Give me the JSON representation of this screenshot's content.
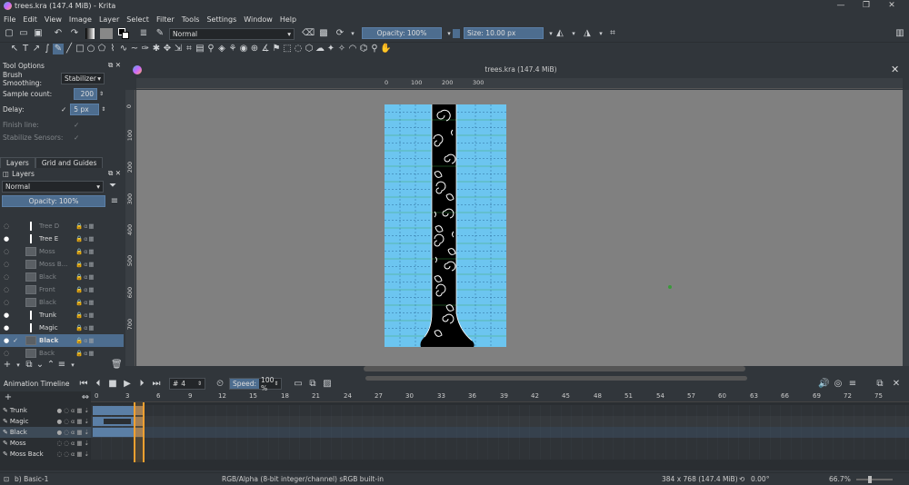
{
  "window": {
    "title": "trees.kra (147.4 MiB)  - Krita",
    "doc_title": "trees.kra (147.4 MiB)"
  },
  "menu": [
    "File",
    "Edit",
    "View",
    "Image",
    "Layer",
    "Select",
    "Filter",
    "Tools",
    "Settings",
    "Window",
    "Help"
  ],
  "toolbar": {
    "blend_mode": "Normal",
    "opacity": "Opacity: 100%",
    "size": "Size: 10.00 px"
  },
  "tool_options": {
    "title": "Tool Options",
    "brush_smoothing_label": "Brush Smoothing:",
    "brush_smoothing_value": "Stabilizer",
    "sample_count_label": "Sample count:",
    "sample_count_value": "200",
    "delay_label": "Delay:",
    "delay_value": "5 px",
    "finish_line_label": "Finish line:",
    "stabilize_label": "Stabilize Sensors:"
  },
  "tabs": {
    "layers": "Layers",
    "grid": "Grid and Guides"
  },
  "layers": {
    "title": "Layers",
    "blend_mode": "Normal",
    "opacity": "Opacity:  100%",
    "items": [
      {
        "name": "Tree D",
        "dim": true
      },
      {
        "name": "Tree E",
        "dim": false
      },
      {
        "name": "Moss",
        "dim": true
      },
      {
        "name": "Moss B...",
        "dim": true
      },
      {
        "name": "Black",
        "dim": true
      },
      {
        "name": "Front",
        "dim": true
      },
      {
        "name": "Black",
        "dim": true
      },
      {
        "name": "Trunk",
        "dim": false
      },
      {
        "name": "Magic",
        "dim": false
      },
      {
        "name": "Black",
        "dim": false,
        "selected": true
      },
      {
        "name": "Back",
        "dim": true
      }
    ]
  },
  "ruler": {
    "top": [
      "0",
      "100",
      "200",
      "300"
    ],
    "left": [
      "0",
      "100",
      "200",
      "300",
      "400",
      "500",
      "600",
      "700"
    ]
  },
  "timeline": {
    "title": "Animation Timeline",
    "frame": "4",
    "speed_label": "Speed:",
    "speed_value": "100 %",
    "frame_numbers": [
      "0",
      "3",
      "6",
      "9",
      "12",
      "15",
      "18",
      "21",
      "24",
      "27",
      "30",
      "33",
      "36",
      "39",
      "42",
      "45",
      "48",
      "51",
      "54",
      "57",
      "60",
      "63",
      "66",
      "69",
      "72",
      "75"
    ],
    "rows": [
      "Trunk",
      "Magic",
      "Black",
      "Moss",
      "Moss Back"
    ]
  },
  "status": {
    "brush": "b) Basic-1",
    "color_space": "RGB/Alpha (8-bit integer/channel)  sRGB built-in",
    "dimensions": "384 x 768 (147.4 MiB)",
    "rotation": "0.00°",
    "zoom": "66.7%"
  },
  "colors": {
    "canvas_bg": "#808080",
    "image_bg": "#6cc5f0",
    "accent": "#4d6d8f",
    "keyframe": "#f0a030"
  }
}
